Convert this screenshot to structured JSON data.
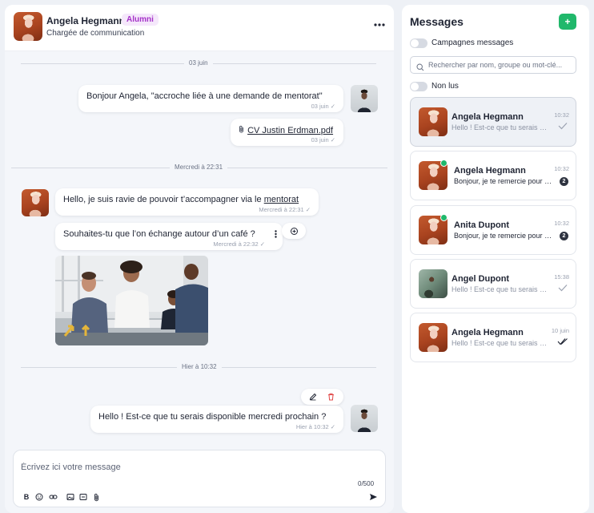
{
  "chat": {
    "header": {
      "name": "Angela Hegmann",
      "badge": "Alumni",
      "role": "Chargée de communication",
      "more_icon": "more-horizontal-icon"
    },
    "separators": [
      "03 juin",
      "Mercredi à 22:31",
      "Hier à 10:32"
    ],
    "messages": [
      {
        "text": "Bonjour Angela, \"accroche liée à une demande de mentorat\"",
        "meta": "03 juin",
        "direction": "outgoing",
        "status": "sent"
      },
      {
        "attachment": "CV Justin Erdman.pdf",
        "attachment_icon": "paperclip-icon",
        "meta": "03 juin",
        "direction": "outgoing",
        "status": "sent"
      },
      {
        "text_before_link": "Hello, je suis ravie de pouvoir t’accompagner via le ",
        "link": "mentorat",
        "meta": "Mercredi à 22:31",
        "direction": "incoming",
        "status": "sent"
      },
      {
        "text": "Souhaites-tu que l’on échange autour d’un café ?",
        "meta": "Mercredi à 22:32",
        "direction": "incoming",
        "status": "sent"
      },
      {
        "image": "office-team-photo",
        "direction": "incoming"
      },
      {
        "text": "Hello ! Est-ce que tu serais disponible mercredi prochain ?",
        "meta": "Hier à 10:32",
        "direction": "outgoing",
        "status": "sent"
      }
    ],
    "composer": {
      "placeholder": "Écrivez ici votre message",
      "value": "",
      "counter": "0/500",
      "tools": [
        "bold-icon",
        "emoji-icon",
        "link-icon",
        "image-icon",
        "gif-icon",
        "attachment-icon"
      ],
      "send_icon": "send-icon"
    }
  },
  "sidebar": {
    "title": "Messages",
    "add_icon": "plus-icon",
    "toggle_campaigns": "Campagnes messages",
    "search_placeholder": "Rechercher par nom, groupe ou mot-clé...",
    "toggle_unread": "Non lus",
    "conversations": [
      {
        "name": "Angela Hegmann",
        "preview": "Hello ! Est-ce que tu serais disponible mercredi prochain ?",
        "time": "10:32",
        "status": "sent",
        "selected": true,
        "online": false,
        "unread": 0
      },
      {
        "name": "Angela Hegmann",
        "preview": "Bonjour, je te remercie pour ton message",
        "time": "10:32",
        "status": "unread",
        "selected": false,
        "online": true,
        "unread": 2
      },
      {
        "name": "Anita Dupont",
        "preview": "Bonjour, je te remercie pour ton message",
        "time": "10:32",
        "status": "unread",
        "selected": false,
        "online": true,
        "unread": 2
      },
      {
        "name": "Angel Dupont",
        "preview": "Hello ! Est-ce que tu serais disponible mercredi prochain ?",
        "time": "15:38",
        "status": "sent",
        "selected": false,
        "online": false,
        "unread": 0
      },
      {
        "name": "Angela Hegmann",
        "preview": "Hello ! Est-ce que tu serais disponible mercredi prochain ?",
        "time": "10 juin",
        "status": "read",
        "selected": false,
        "online": false,
        "unread": 0
      }
    ]
  },
  "colors": {
    "accent_green": "#20b86b",
    "badge_purple": "#a532c8",
    "delete_red": "#e04646",
    "page_bg": "#eef1f6"
  }
}
